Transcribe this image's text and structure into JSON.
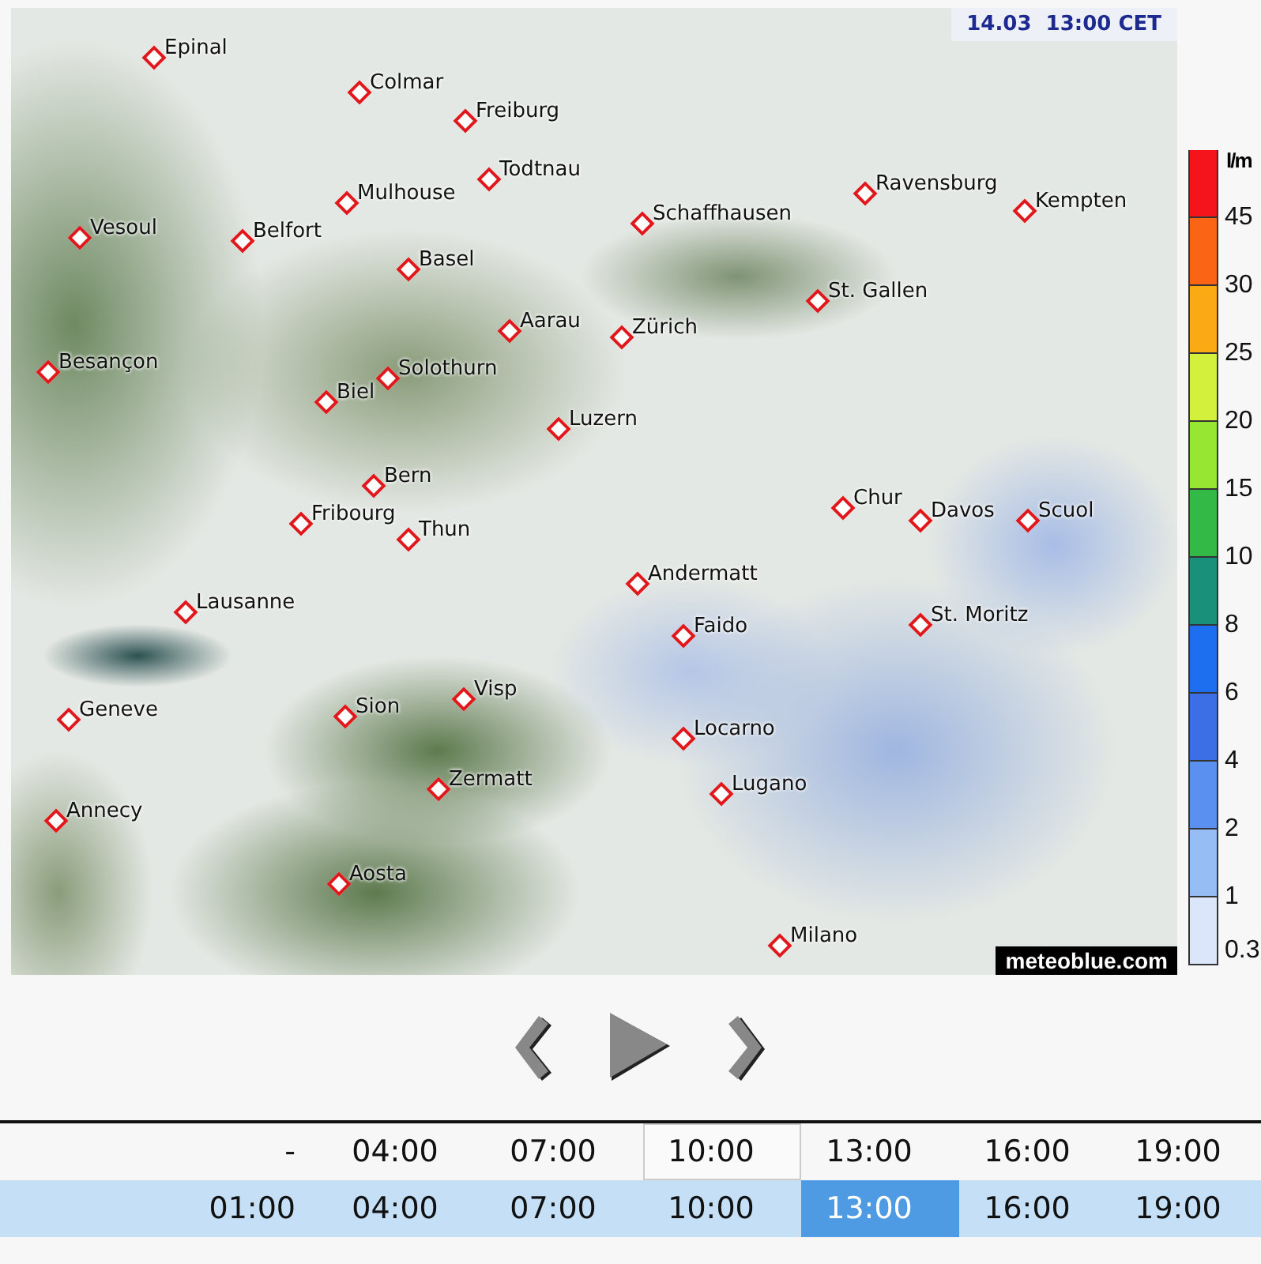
{
  "map": {
    "timestamp": "14.03  13:00 CET",
    "credit": "meteoblue.com",
    "cities": [
      {
        "name": "Epinal"
      },
      {
        "name": "Colmar"
      },
      {
        "name": "Freiburg"
      },
      {
        "name": "Todtnau"
      },
      {
        "name": "Mulhouse"
      },
      {
        "name": "Vesoul"
      },
      {
        "name": "Belfort"
      },
      {
        "name": "Basel"
      },
      {
        "name": "Schaffhausen"
      },
      {
        "name": "Ravensburg"
      },
      {
        "name": "Kempten"
      },
      {
        "name": "St. Gallen"
      },
      {
        "name": "Aarau"
      },
      {
        "name": "Zürich"
      },
      {
        "name": "Besançon"
      },
      {
        "name": "Solothurn"
      },
      {
        "name": "Biel"
      },
      {
        "name": "Luzern"
      },
      {
        "name": "Bern"
      },
      {
        "name": "Fribourg"
      },
      {
        "name": "Thun"
      },
      {
        "name": "Chur"
      },
      {
        "name": "Davos"
      },
      {
        "name": "Scuol"
      },
      {
        "name": "Andermatt"
      },
      {
        "name": "Lausanne"
      },
      {
        "name": "St. Moritz"
      },
      {
        "name": "Faido"
      },
      {
        "name": "Visp"
      },
      {
        "name": "Sion"
      },
      {
        "name": "Geneve"
      },
      {
        "name": "Locarno"
      },
      {
        "name": "Lugano"
      },
      {
        "name": "Zermatt"
      },
      {
        "name": "Annecy"
      },
      {
        "name": "Aosta"
      },
      {
        "name": "Milano"
      }
    ]
  },
  "legend": {
    "unit": "l/m",
    "classes": [
      {
        "label": "45",
        "color": "#f5141c"
      },
      {
        "label": "30",
        "color": "#fa6414"
      },
      {
        "label": "25",
        "color": "#fcaa14"
      },
      {
        "label": "20",
        "color": "#d2f03c"
      },
      {
        "label": "15",
        "color": "#96e632"
      },
      {
        "label": "10",
        "color": "#32b946"
      },
      {
        "label": "8",
        "color": "#19917a"
      },
      {
        "label": "6",
        "color": "#1e6ef0"
      },
      {
        "label": "4",
        "color": "#3c6ee6"
      },
      {
        "label": "2",
        "color": "#5a91f0"
      },
      {
        "label": "1",
        "color": "#96bef5"
      },
      {
        "label": "0.3",
        "color": "#dce6fa"
      }
    ]
  },
  "timeline": {
    "rows": [
      {
        "selected": false,
        "cells": [
          {
            "text": "-",
            "selected": false,
            "current": false
          },
          {
            "text": "04:00",
            "selected": false,
            "current": false
          },
          {
            "text": "07:00",
            "selected": false,
            "current": false
          },
          {
            "text": "10:00",
            "selected": false,
            "current": true
          },
          {
            "text": "13:00",
            "selected": false,
            "current": false
          },
          {
            "text": "16:00",
            "selected": false,
            "current": false
          },
          {
            "text": "19:00",
            "selected": false,
            "current": false
          }
        ]
      },
      {
        "selected": true,
        "cells": [
          {
            "text": "01:00",
            "selected": false,
            "current": false
          },
          {
            "text": "04:00",
            "selected": false,
            "current": false
          },
          {
            "text": "07:00",
            "selected": false,
            "current": false
          },
          {
            "text": "10:00",
            "selected": false,
            "current": false
          },
          {
            "text": "13:00",
            "selected": true,
            "current": false
          },
          {
            "text": "16:00",
            "selected": false,
            "current": false
          },
          {
            "text": "19:00",
            "selected": false,
            "current": false
          }
        ]
      }
    ]
  }
}
